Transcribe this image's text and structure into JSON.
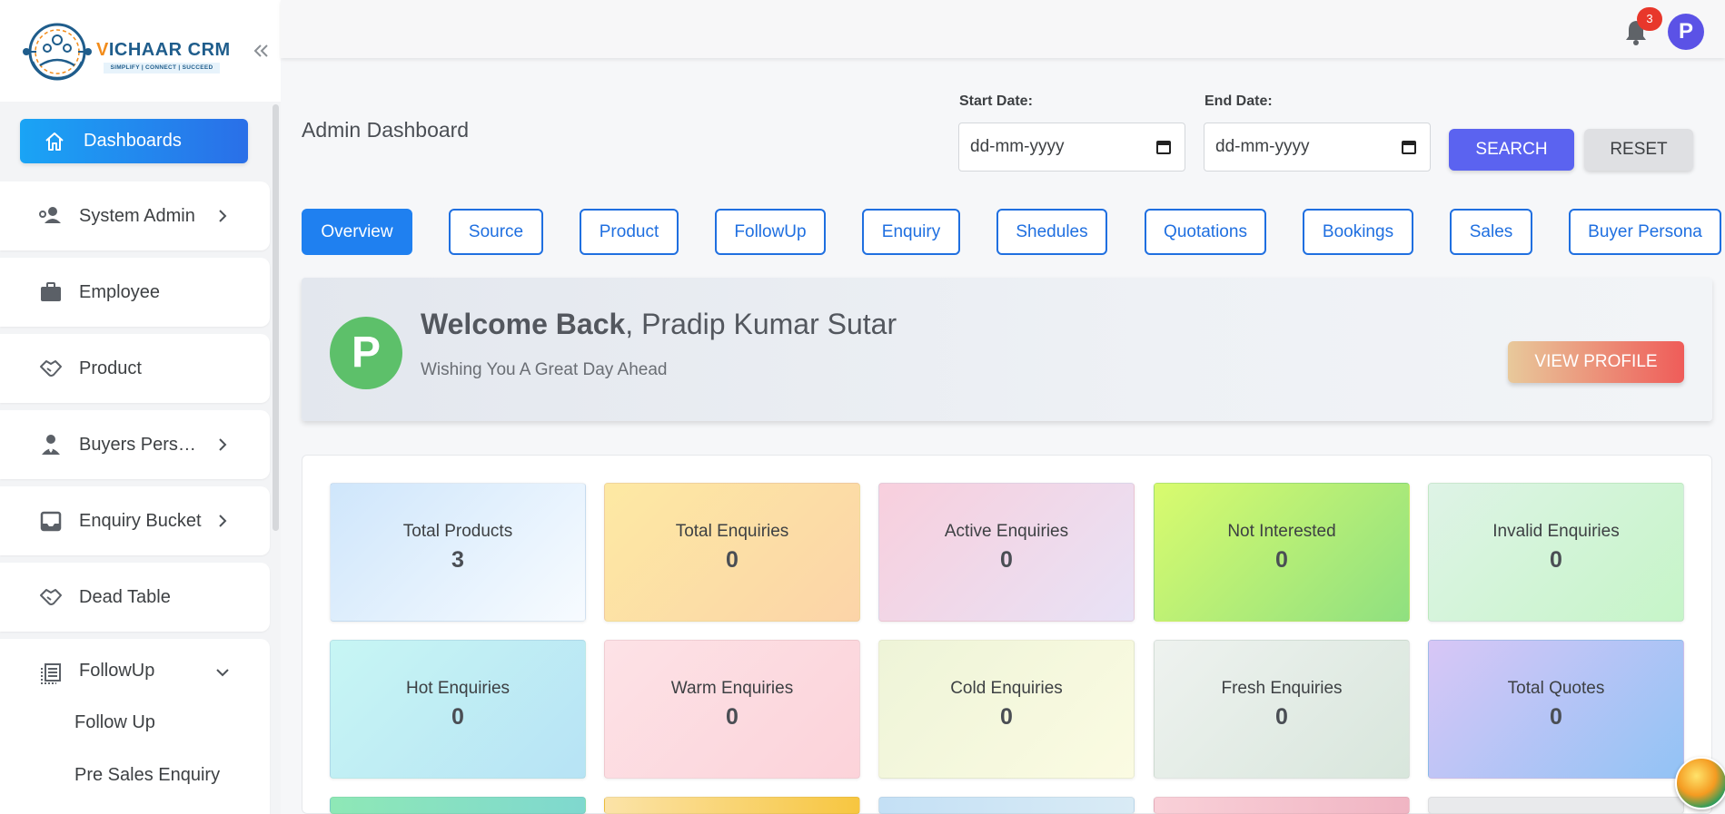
{
  "brand": {
    "name_v": "V",
    "name_rest": "ICHAAR CRM",
    "tagline": "SIMPLIFY | CONNECT | SUCCEED"
  },
  "sidebar": {
    "active_item": {
      "label": "Dashboards",
      "icon": "home-icon"
    },
    "items": [
      {
        "label": "System Admin",
        "icon": "user-cog-icon",
        "has_children": true
      },
      {
        "label": "Employee",
        "icon": "briefcase-icon",
        "has_children": false
      },
      {
        "label": "Product",
        "icon": "handshake-icon",
        "has_children": false
      },
      {
        "label": "Buyers Pers…",
        "icon": "buyer-tie-icon",
        "has_children": true
      },
      {
        "label": "Enquiry Bucket",
        "icon": "inbox-icon",
        "has_children": true
      },
      {
        "label": "Dead Table",
        "icon": "handshake-icon",
        "has_children": false
      },
      {
        "label": "FollowUp",
        "icon": "list-icon",
        "has_children": true,
        "expanded": true
      }
    ],
    "subitems": [
      "Follow Up",
      "Pre Sales Enquiry"
    ]
  },
  "header": {
    "notification_count": "3",
    "user_initial": "P"
  },
  "page": {
    "title": "Admin Dashboard",
    "start_date_label": "Start Date:",
    "end_date_label": "End Date:",
    "start_date_value": "dd-mm-yyyy",
    "end_date_value": "dd-mm-yyyy",
    "search_label": "SEARCH",
    "reset_label": "RESET"
  },
  "tabs": [
    "Overview",
    "Source",
    "Product",
    "FollowUp",
    "Enquiry",
    "Shedules",
    "Quotations",
    "Bookings",
    "Sales",
    "Buyer Persona"
  ],
  "active_tab": "Overview",
  "welcome": {
    "initial": "P",
    "greeting": "Welcome Back",
    "name": ", Pradip Kumar Sutar",
    "subtitle": "Wishing You A Great Day Ahead",
    "button_label": "VIEW PROFILE"
  },
  "stats": [
    {
      "label": "Total Products",
      "value": "3"
    },
    {
      "label": "Total Enquiries",
      "value": "0"
    },
    {
      "label": "Active Enquiries",
      "value": "0"
    },
    {
      "label": "Not Interested",
      "value": "0"
    },
    {
      "label": "Invalid Enquiries",
      "value": "0"
    },
    {
      "label": "Hot Enquiries",
      "value": "0"
    },
    {
      "label": "Warm Enquiries",
      "value": "0"
    },
    {
      "label": "Cold Enquiries",
      "value": "0"
    },
    {
      "label": "Fresh Enquiries",
      "value": "0"
    },
    {
      "label": "Total Quotes",
      "value": "0"
    }
  ],
  "colors": {
    "primary": "#1f80f0",
    "search": "#5b63f0",
    "badge": "#e8372b",
    "avatar": "#5b52e6",
    "welcome_avatar": "#5dc06a"
  }
}
